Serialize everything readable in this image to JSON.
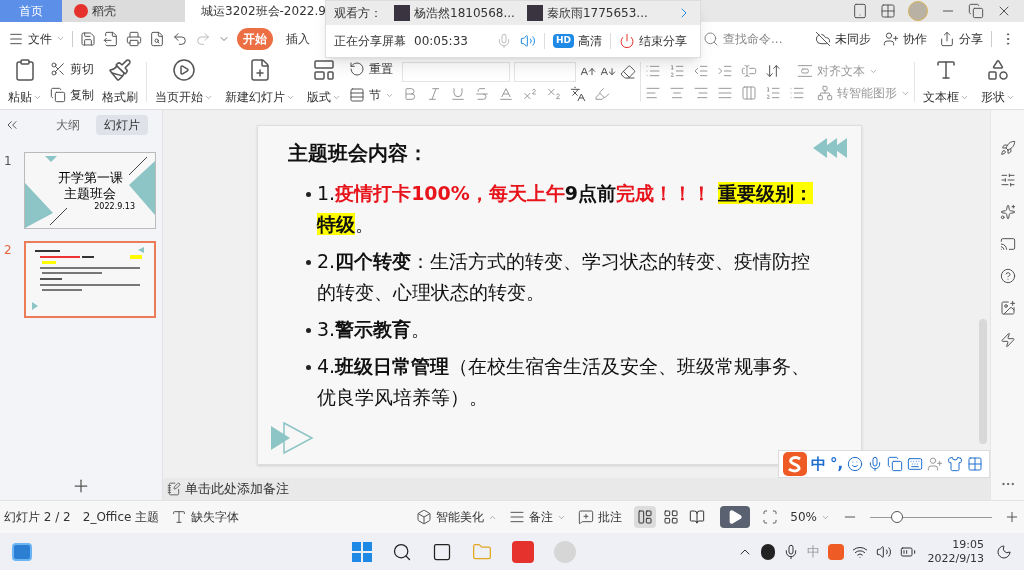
{
  "title_bar": {
    "tabs": [
      {
        "label": "首页",
        "kind": "home",
        "selected": false
      },
      {
        "label": "稻壳",
        "kind": "app",
        "selected": false
      },
      {
        "label": "城运3202班会-2022.9",
        "kind": "document",
        "selected": true
      }
    ]
  },
  "share_panel": {
    "label": "观看方：",
    "viewers": [
      "杨浩然1810568...",
      "秦欣雨1775653..."
    ],
    "status": "正在分享屏幕",
    "timer": "00:05:33",
    "quality_badge": "HD",
    "quality": "高清",
    "end_button": "结束分享"
  },
  "menu_bar": {
    "file": "文件",
    "tabs": [
      {
        "label": "开始",
        "selected": true
      },
      {
        "label": "插入",
        "selected": false
      }
    ],
    "search": {
      "placeholder": "查找命令..."
    },
    "actions": [
      "未同步",
      "协作",
      "分享"
    ]
  },
  "ribbon": {
    "paste": "粘贴",
    "cut": "剪切",
    "copy": "复制",
    "format_painter": "格式刷",
    "play_from_current": "当页开始",
    "new_slide": "新建幻灯片",
    "layout": "版式",
    "reset": "重置",
    "section": "节",
    "align_text": "对齐文本",
    "smart_art": "转智能图形",
    "text_box": "文本框",
    "shape": "形状"
  },
  "panel": {
    "tabs": [
      {
        "label": "大纲",
        "selected": false
      },
      {
        "label": "幻灯片",
        "selected": true
      }
    ],
    "slides": [
      {
        "number": "1",
        "kind": "title",
        "selected": false,
        "title": "开学第一课",
        "subtitle": "主题班会",
        "date": "2022.9.13"
      },
      {
        "number": "2",
        "kind": "content",
        "selected": true
      }
    ]
  },
  "slide": {
    "heading": "主题班会内容：",
    "bullets": [
      {
        "segments": [
          {
            "text": "1.",
            "bold": false,
            "red": false,
            "highlight": false
          },
          {
            "text": "疫情打卡100%，每天上午",
            "bold": true,
            "red": true,
            "highlight": false
          },
          {
            "text": "9点前",
            "bold": true,
            "red": false,
            "highlight": false
          },
          {
            "text": "完成！！！ ",
            "bold": true,
            "red": true,
            "highlight": false
          },
          {
            "text": "重要级别：特级",
            "bold": true,
            "red": false,
            "highlight": true
          },
          {
            "text": "。",
            "bold": false,
            "red": false,
            "highlight": false
          }
        ]
      },
      {
        "segments": [
          {
            "text": "2.",
            "bold": false,
            "red": false,
            "highlight": false
          },
          {
            "text": "四个转变",
            "bold": true,
            "red": false,
            "highlight": false
          },
          {
            "text": "：生活方式的转变、学习状态的转变、疫情防控的转变、心理状态的转变。",
            "bold": false,
            "red": false,
            "highlight": false
          }
        ]
      },
      {
        "segments": [
          {
            "text": "3.",
            "bold": false,
            "red": false,
            "highlight": false
          },
          {
            "text": "警示教育",
            "bold": true,
            "red": false,
            "highlight": false
          },
          {
            "text": "。",
            "bold": false,
            "red": false,
            "highlight": false
          }
        ]
      },
      {
        "segments": [
          {
            "text": "4.",
            "bold": false,
            "red": false,
            "highlight": false
          },
          {
            "text": "班级日常管理",
            "bold": true,
            "red": false,
            "highlight": false
          },
          {
            "text": "（在校生宿舍生活及安全、班级常规事务、优良学风培养等）。",
            "bold": false,
            "red": false,
            "highlight": false
          }
        ]
      }
    ]
  },
  "notes": {
    "placeholder": "单击此处添加备注"
  },
  "ime_bar": {
    "mode": "中",
    "punctuation": "°,"
  },
  "status_bar": {
    "slide_info": "幻灯片 2 / 2",
    "theme": "2_Office 主题",
    "missing_font": "缺失字体",
    "beautify": "智能美化",
    "notes": "备注",
    "comments": "批注",
    "views": [
      {
        "kind": "normal",
        "selected": true
      },
      {
        "kind": "sorter",
        "selected": false
      },
      {
        "kind": "reading",
        "selected": false
      }
    ],
    "zoom": "50%",
    "zoom_slider": {
      "level": 0.22
    }
  },
  "taskbar": {
    "ime": "中",
    "time": "19:05",
    "date": "2022/9/13"
  }
}
